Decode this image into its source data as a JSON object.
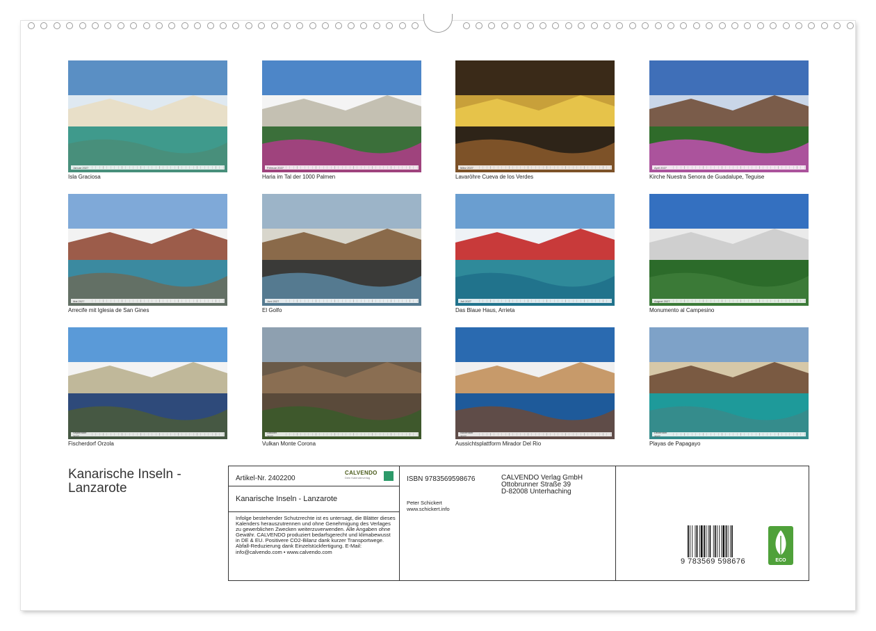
{
  "calendar": {
    "title": "Kanarische Inseln - Lanzarote",
    "months": [
      {
        "label": "Januar 2027",
        "caption": "Isla Graciosa",
        "icon": "beach-photo"
      },
      {
        "label": "Februar 2027",
        "caption": "Haria im Tal der 1000 Palmen",
        "icon": "village-photo"
      },
      {
        "label": "März 2027",
        "caption": "Lavaröhre Cueva de los Verdes",
        "icon": "cave-photo"
      },
      {
        "label": "April 2027",
        "caption": "Kirche Nuestra Senora de Guadalupe, Teguise",
        "icon": "church-photo"
      },
      {
        "label": "Mai 2027",
        "caption": "Arrecife mit Iglesia de San Gines",
        "icon": "harbor-photo"
      },
      {
        "label": "Juni 2027",
        "caption": "El Golfo",
        "icon": "coast-photo"
      },
      {
        "label": "Juli 2027",
        "caption": "Das Blaue Haus, Arrieta",
        "icon": "house-photo"
      },
      {
        "label": "August 2027",
        "caption": "Monumento al Campesino",
        "icon": "monument-photo"
      },
      {
        "label": "September 2027",
        "caption": "Fischerdorf Orzola",
        "icon": "village-reflection-photo"
      },
      {
        "label": "Oktober 2027",
        "caption": "Vulkan Monte Corona",
        "icon": "volcano-photo"
      },
      {
        "label": "November 2027",
        "caption": "Aussichtsplattform Mirador Del Rio",
        "icon": "viewpoint-photo"
      },
      {
        "label": "Dezember 2027",
        "caption": "Playas de Papagayo",
        "icon": "bay-photo"
      }
    ]
  },
  "info": {
    "article": "Artikel-Nr. 2402200",
    "title": "Kanarische Inseln - Lanzarote",
    "logo_brand": "CALVENDO",
    "logo_sub": "Dein Kalenderverlag",
    "legal": "Infolge bestehender Schutzrechte ist es untersagt, die Blätter dieses Kalenders herauszutrennen und ohne Genehmigung des Verlages zu gewerblichen Zwecken weiterzuverwenden. Alle Angaben ohne Gewähr. CALVENDO produziert bedarfsgerecht und klimabewusst in DE & EU. Positivere CO2-Bilanz dank kurzer Transportwege. Abfall-Reduzierung dank Einzelstückfertigung. E-Mail: info@calvendo.com • www.calvendo.com",
    "isbn": "ISBN 9783569598676",
    "author": "Peter Schickert",
    "author_url": "www.schickert.info",
    "publisher_name": "CALVENDO Verlag GmbH",
    "publisher_street": "Ottobrunner Straße 39",
    "publisher_city": "D-82008 Unterhaching",
    "barcode_text": "9 783569 598676",
    "eco_label": "ECO"
  },
  "colors": {
    "frame": "#333333",
    "eco": "#4fa13a"
  }
}
